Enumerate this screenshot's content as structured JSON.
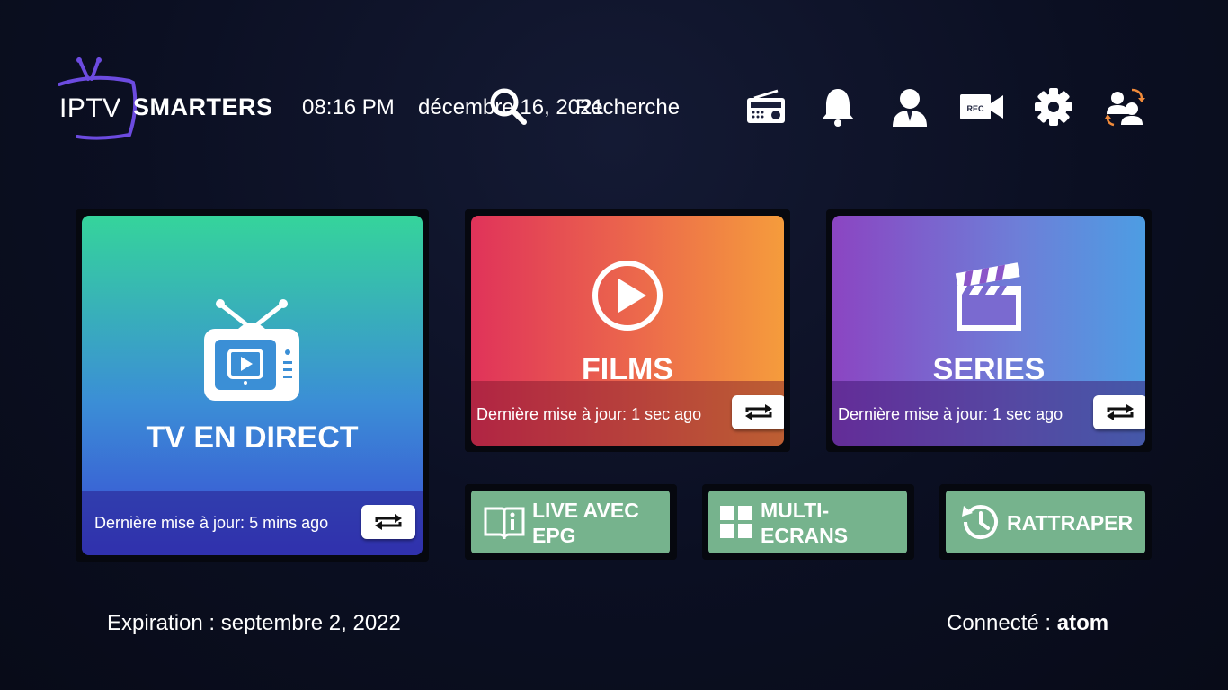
{
  "header": {
    "logo_iptv": "IPTV",
    "logo_smarters": "SMARTERS",
    "time": "08:16 PM",
    "date": "décembre 16, 2021",
    "search_label": "Recherche",
    "icons": [
      "radio-icon",
      "bell-icon",
      "user-icon",
      "rec-camera-icon",
      "gear-icon",
      "switch-users-icon"
    ],
    "rec_text": "REC"
  },
  "tiles": {
    "live": {
      "title": "TV EN DIRECT",
      "updated": "Dernière mise à jour: 5 mins ago",
      "icon": "tv-icon"
    },
    "films": {
      "title": "FILMS",
      "updated": "Dernière mise à jour: 1 sec ago",
      "icon": "play-circle-icon"
    },
    "series": {
      "title": "SERIES",
      "updated": "Dernière mise à jour: 1 sec ago",
      "icon": "clapperboard-icon"
    }
  },
  "buttons": {
    "epg": {
      "line1": "LIVE AVEC",
      "line2": "EPG",
      "icon": "book-info-icon"
    },
    "multi": {
      "line1": "MULTI-",
      "line2": "ECRANS",
      "icon": "grid-icon"
    },
    "catchup": {
      "label": "RATTRAPER",
      "icon": "history-icon"
    }
  },
  "footer": {
    "expiration": "Expiration : septembre 2, 2022",
    "connected_label": "Connecté : ",
    "username": "atom"
  },
  "colors": {
    "background": "#0b0f22",
    "button_green": "#76b38d",
    "logo_purple": "#6c4be0"
  }
}
